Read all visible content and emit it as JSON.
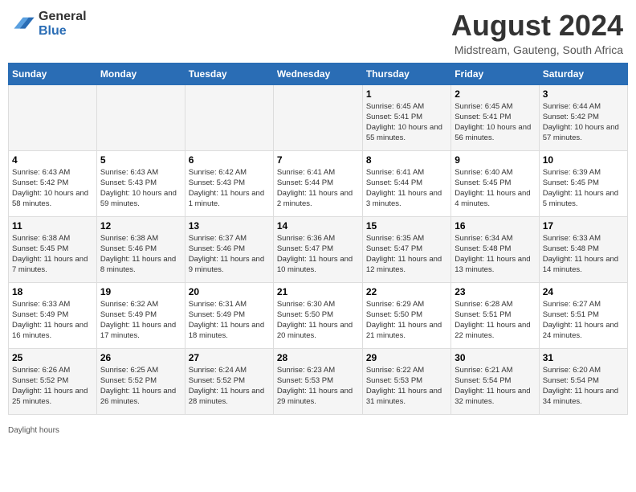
{
  "header": {
    "logo_general": "General",
    "logo_blue": "Blue",
    "month_title": "August 2024",
    "location": "Midstream, Gauteng, South Africa"
  },
  "calendar": {
    "days_of_week": [
      "Sunday",
      "Monday",
      "Tuesday",
      "Wednesday",
      "Thursday",
      "Friday",
      "Saturday"
    ],
    "weeks": [
      [
        {
          "day": "",
          "info": ""
        },
        {
          "day": "",
          "info": ""
        },
        {
          "day": "",
          "info": ""
        },
        {
          "day": "",
          "info": ""
        },
        {
          "day": "1",
          "info": "Sunrise: 6:45 AM\nSunset: 5:41 PM\nDaylight: 10 hours and 55 minutes."
        },
        {
          "day": "2",
          "info": "Sunrise: 6:45 AM\nSunset: 5:41 PM\nDaylight: 10 hours and 56 minutes."
        },
        {
          "day": "3",
          "info": "Sunrise: 6:44 AM\nSunset: 5:42 PM\nDaylight: 10 hours and 57 minutes."
        }
      ],
      [
        {
          "day": "4",
          "info": "Sunrise: 6:43 AM\nSunset: 5:42 PM\nDaylight: 10 hours and 58 minutes."
        },
        {
          "day": "5",
          "info": "Sunrise: 6:43 AM\nSunset: 5:43 PM\nDaylight: 10 hours and 59 minutes."
        },
        {
          "day": "6",
          "info": "Sunrise: 6:42 AM\nSunset: 5:43 PM\nDaylight: 11 hours and 1 minute."
        },
        {
          "day": "7",
          "info": "Sunrise: 6:41 AM\nSunset: 5:44 PM\nDaylight: 11 hours and 2 minutes."
        },
        {
          "day": "8",
          "info": "Sunrise: 6:41 AM\nSunset: 5:44 PM\nDaylight: 11 hours and 3 minutes."
        },
        {
          "day": "9",
          "info": "Sunrise: 6:40 AM\nSunset: 5:45 PM\nDaylight: 11 hours and 4 minutes."
        },
        {
          "day": "10",
          "info": "Sunrise: 6:39 AM\nSunset: 5:45 PM\nDaylight: 11 hours and 5 minutes."
        }
      ],
      [
        {
          "day": "11",
          "info": "Sunrise: 6:38 AM\nSunset: 5:45 PM\nDaylight: 11 hours and 7 minutes."
        },
        {
          "day": "12",
          "info": "Sunrise: 6:38 AM\nSunset: 5:46 PM\nDaylight: 11 hours and 8 minutes."
        },
        {
          "day": "13",
          "info": "Sunrise: 6:37 AM\nSunset: 5:46 PM\nDaylight: 11 hours and 9 minutes."
        },
        {
          "day": "14",
          "info": "Sunrise: 6:36 AM\nSunset: 5:47 PM\nDaylight: 11 hours and 10 minutes."
        },
        {
          "day": "15",
          "info": "Sunrise: 6:35 AM\nSunset: 5:47 PM\nDaylight: 11 hours and 12 minutes."
        },
        {
          "day": "16",
          "info": "Sunrise: 6:34 AM\nSunset: 5:48 PM\nDaylight: 11 hours and 13 minutes."
        },
        {
          "day": "17",
          "info": "Sunrise: 6:33 AM\nSunset: 5:48 PM\nDaylight: 11 hours and 14 minutes."
        }
      ],
      [
        {
          "day": "18",
          "info": "Sunrise: 6:33 AM\nSunset: 5:49 PM\nDaylight: 11 hours and 16 minutes."
        },
        {
          "day": "19",
          "info": "Sunrise: 6:32 AM\nSunset: 5:49 PM\nDaylight: 11 hours and 17 minutes."
        },
        {
          "day": "20",
          "info": "Sunrise: 6:31 AM\nSunset: 5:49 PM\nDaylight: 11 hours and 18 minutes."
        },
        {
          "day": "21",
          "info": "Sunrise: 6:30 AM\nSunset: 5:50 PM\nDaylight: 11 hours and 20 minutes."
        },
        {
          "day": "22",
          "info": "Sunrise: 6:29 AM\nSunset: 5:50 PM\nDaylight: 11 hours and 21 minutes."
        },
        {
          "day": "23",
          "info": "Sunrise: 6:28 AM\nSunset: 5:51 PM\nDaylight: 11 hours and 22 minutes."
        },
        {
          "day": "24",
          "info": "Sunrise: 6:27 AM\nSunset: 5:51 PM\nDaylight: 11 hours and 24 minutes."
        }
      ],
      [
        {
          "day": "25",
          "info": "Sunrise: 6:26 AM\nSunset: 5:52 PM\nDaylight: 11 hours and 25 minutes."
        },
        {
          "day": "26",
          "info": "Sunrise: 6:25 AM\nSunset: 5:52 PM\nDaylight: 11 hours and 26 minutes."
        },
        {
          "day": "27",
          "info": "Sunrise: 6:24 AM\nSunset: 5:52 PM\nDaylight: 11 hours and 28 minutes."
        },
        {
          "day": "28",
          "info": "Sunrise: 6:23 AM\nSunset: 5:53 PM\nDaylight: 11 hours and 29 minutes."
        },
        {
          "day": "29",
          "info": "Sunrise: 6:22 AM\nSunset: 5:53 PM\nDaylight: 11 hours and 31 minutes."
        },
        {
          "day": "30",
          "info": "Sunrise: 6:21 AM\nSunset: 5:54 PM\nDaylight: 11 hours and 32 minutes."
        },
        {
          "day": "31",
          "info": "Sunrise: 6:20 AM\nSunset: 5:54 PM\nDaylight: 11 hours and 34 minutes."
        }
      ]
    ]
  },
  "footer": {
    "note": "Daylight hours"
  }
}
